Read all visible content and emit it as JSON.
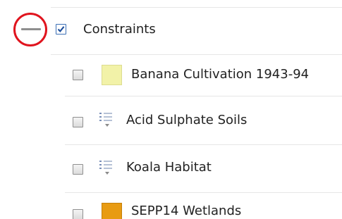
{
  "layers": {
    "group": {
      "label": "Constraints",
      "checked": true
    },
    "items": [
      {
        "label": "Banana Cultivation 1943-94",
        "icon": "color-swatch",
        "swatch_color": "#f2f2a8",
        "checked": false
      },
      {
        "label": "Acid Sulphate Soils",
        "icon": "legend-list-icon",
        "checked": false
      },
      {
        "label": "Koala Habitat",
        "icon": "legend-list-icon",
        "checked": false
      },
      {
        "label": "SEPP14 Wetlands",
        "icon": "color-swatch",
        "swatch_color": "#e89b12",
        "checked": false
      }
    ]
  },
  "icons": {
    "collapse": "minus-icon",
    "annotation": "red-circle-highlight"
  }
}
